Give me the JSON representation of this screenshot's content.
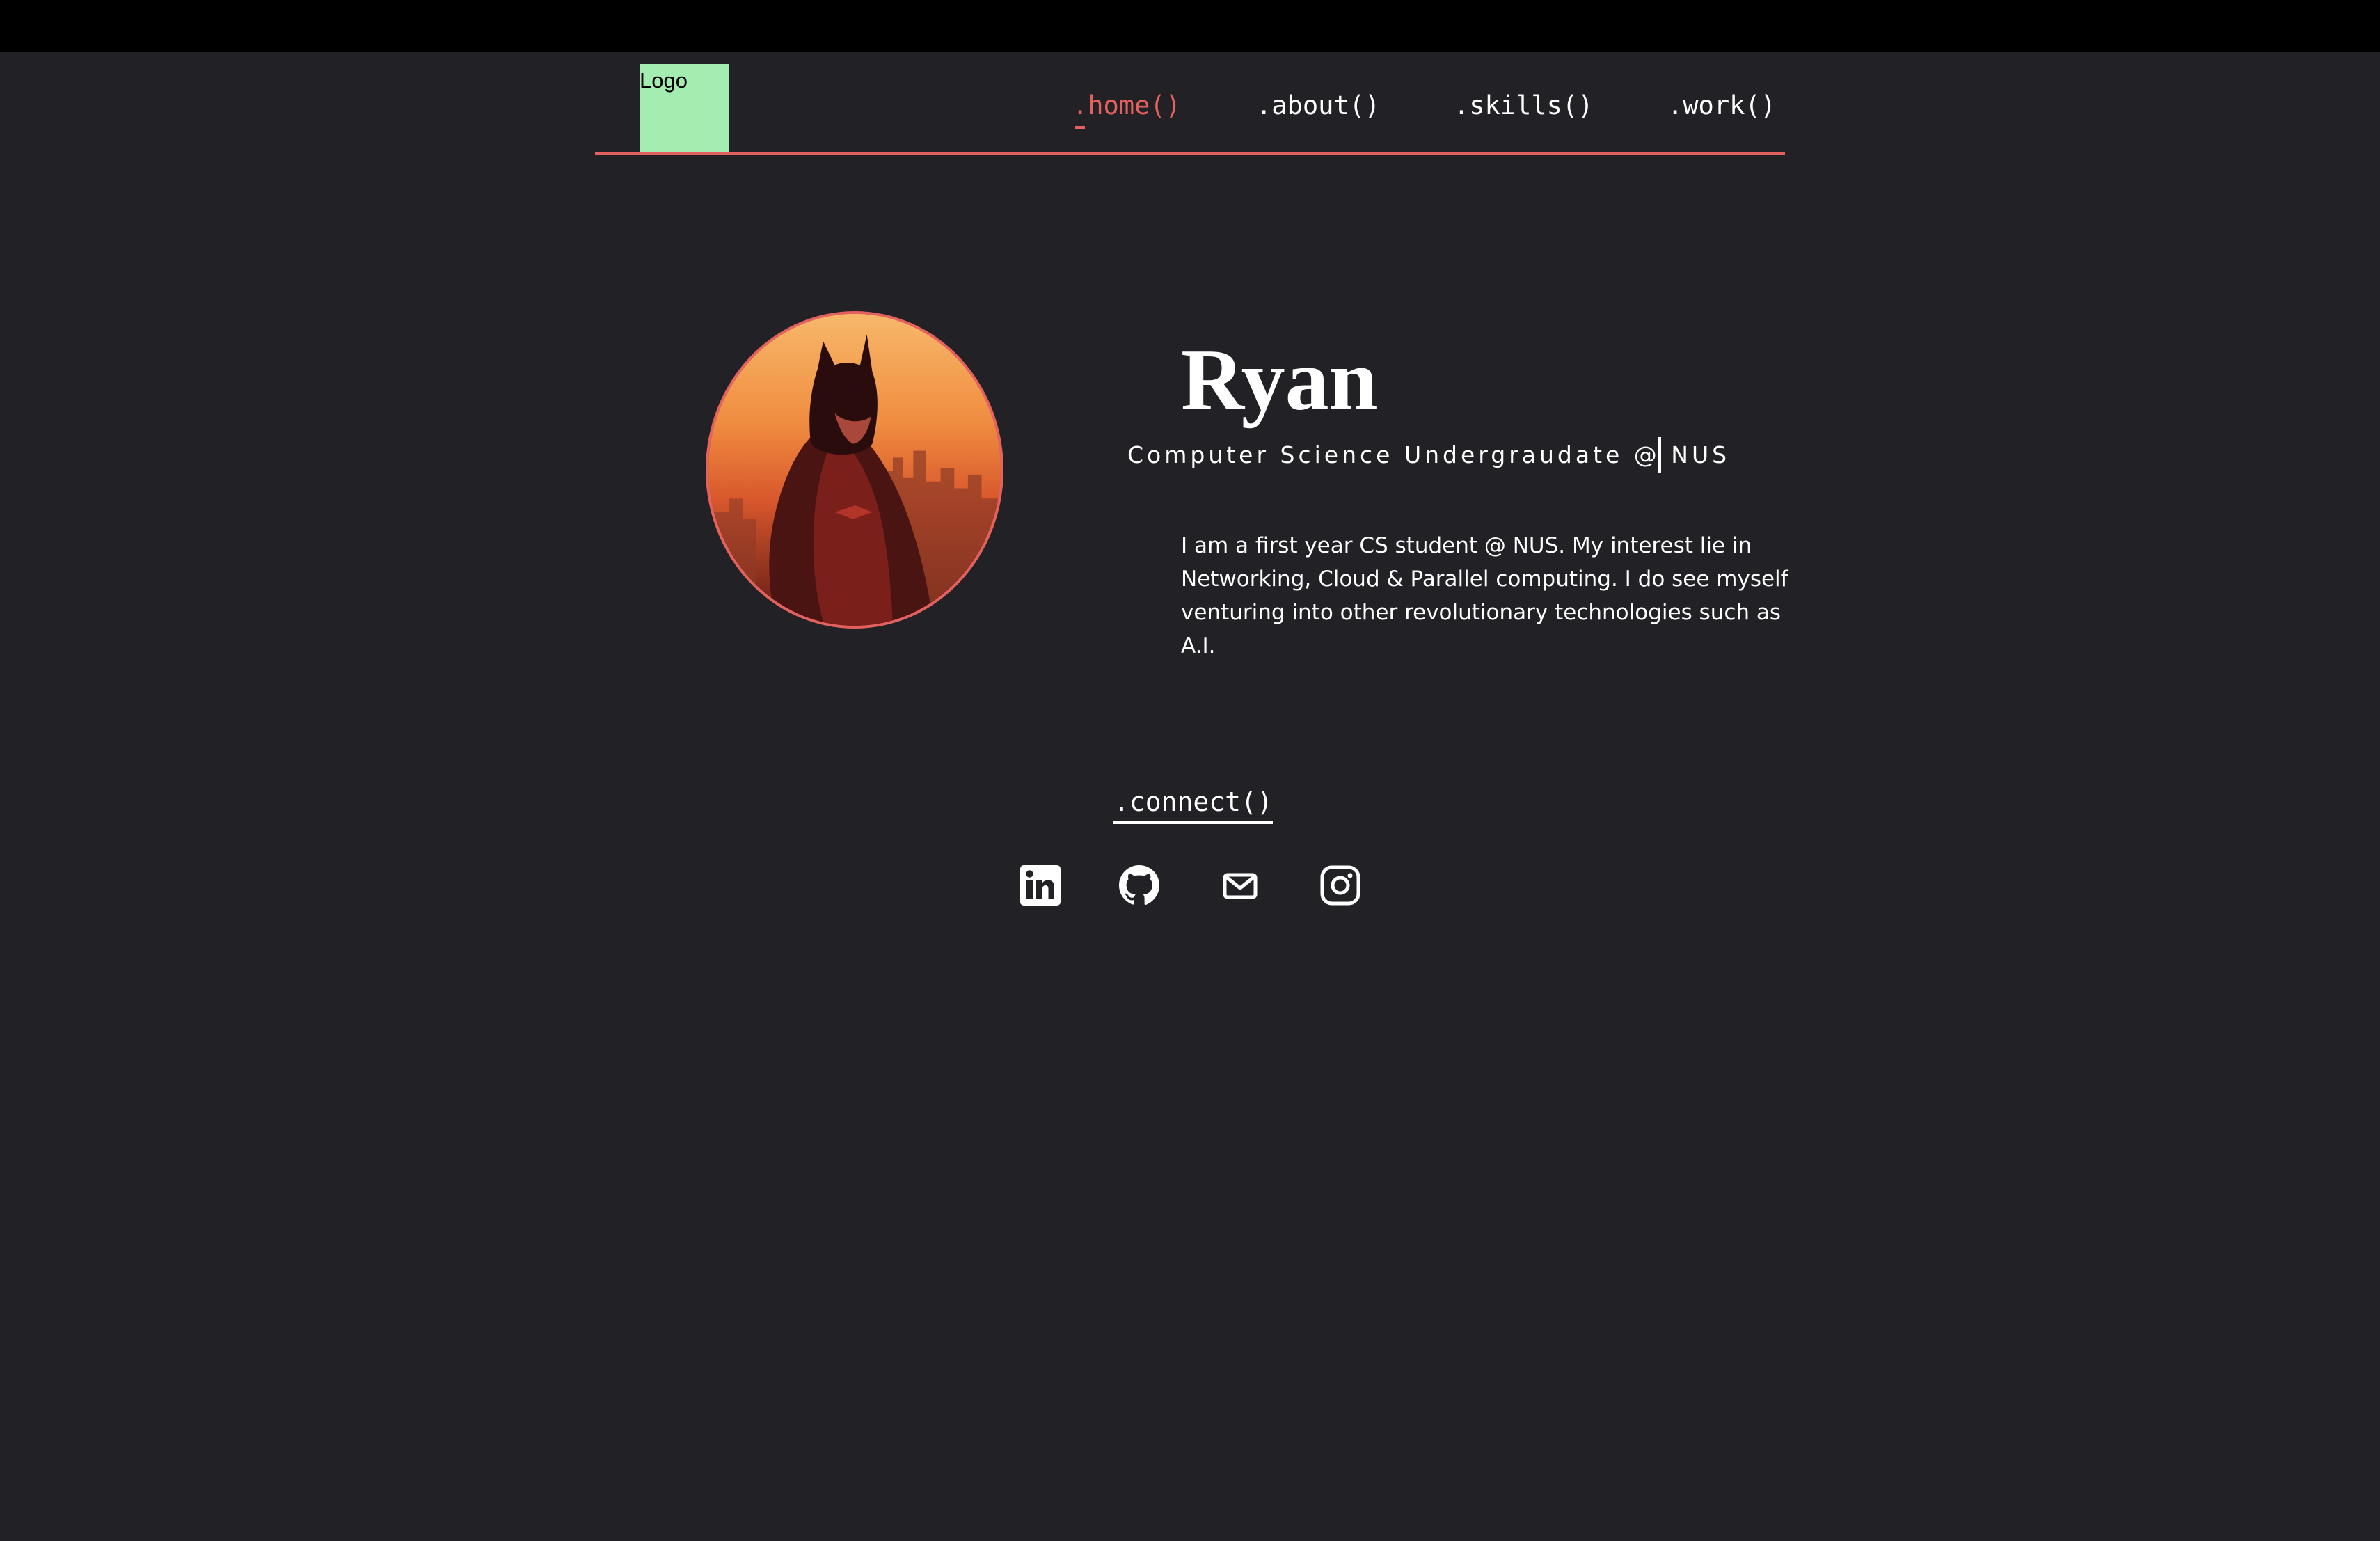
{
  "logo": {
    "label": "Logo",
    "color": "#a3edb1"
  },
  "nav": {
    "items": [
      {
        "label": ".home()",
        "active": true
      },
      {
        "label": ".about()",
        "active": false
      },
      {
        "label": ".skills()",
        "active": false
      },
      {
        "label": ".work()",
        "active": false
      }
    ],
    "accent_color": "#e3615f"
  },
  "profile": {
    "name": "Ryan",
    "subtitle": "Computer Science Undergraudate @ NUS",
    "bio": "I am a first year CS student @ NUS. My interest lie in Networking, Cloud & Parallel computing. I do see myself venturing into other revolutionary technologies such as A.I.",
    "avatar_icon": "batman-portrait"
  },
  "connect": {
    "label": ".connect()",
    "links": [
      {
        "icon": "linkedin-icon"
      },
      {
        "icon": "github-icon"
      },
      {
        "icon": "mail-icon"
      },
      {
        "icon": "instagram-icon"
      }
    ]
  },
  "theme": {
    "background": "#222125",
    "top_bar": "#000000",
    "text": "#ffffff"
  }
}
